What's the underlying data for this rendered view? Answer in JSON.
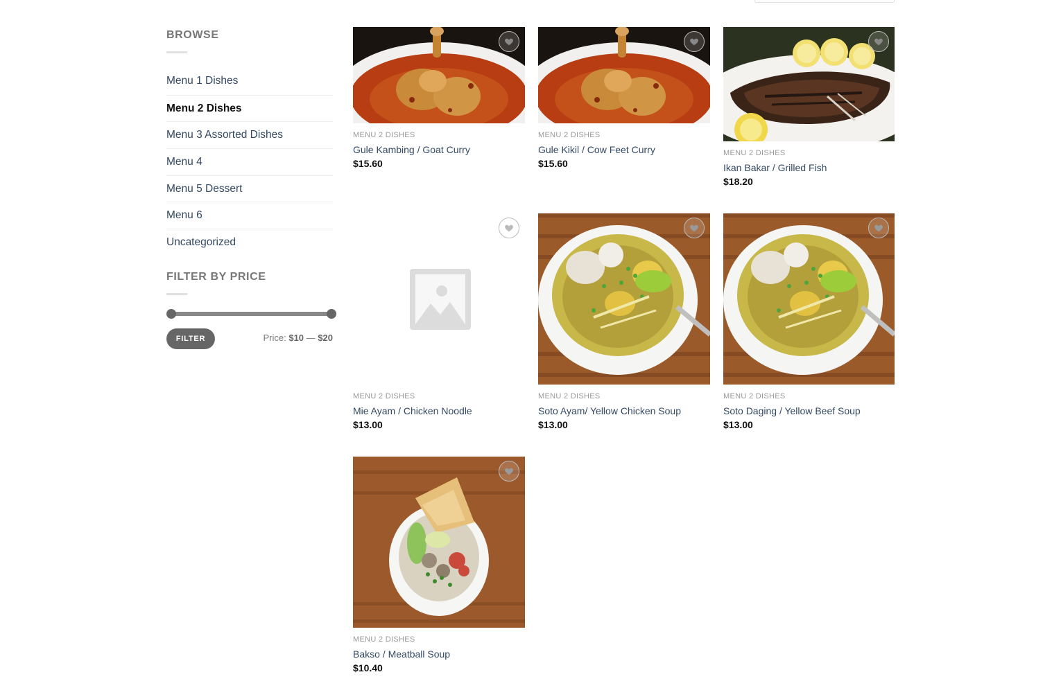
{
  "sidebar": {
    "browse_title": "BROWSE",
    "categories": [
      {
        "label": "Menu 1 Dishes"
      },
      {
        "label": "Menu 2 Dishes"
      },
      {
        "label": "Menu 3 Assorted Dishes"
      },
      {
        "label": "Menu 4"
      },
      {
        "label": "Menu 5 Dessert"
      },
      {
        "label": "Menu 6"
      },
      {
        "label": "Uncategorized"
      }
    ],
    "active_category": "Menu 2 Dishes",
    "price_title": "FILTER BY PRICE",
    "filter_button": "FILTER",
    "price_prefix": "Price:",
    "price_min": "$10",
    "price_separator": "—",
    "price_max": "$20"
  },
  "products": [
    {
      "category": "MENU 2 DISHES",
      "name": "Gule Kambing / Goat Curry",
      "price": "$15.60",
      "image": "curry"
    },
    {
      "category": "MENU 2 DISHES",
      "name": "Gule Kikil / Cow Feet Curry",
      "price": "$15.60",
      "image": "curry"
    },
    {
      "category": "MENU 2 DISHES",
      "name": "Ikan Bakar / Grilled Fish",
      "price": "$18.20",
      "image": "grilled-fish"
    },
    {
      "category": "MENU 2 DISHES",
      "name": "Mie Ayam / Chicken Noodle",
      "price": "$13.00",
      "image": "placeholder"
    },
    {
      "category": "MENU 2 DISHES",
      "name": "Soto Ayam/ Yellow Chicken Soup",
      "price": "$13.00",
      "image": "yellow-soup"
    },
    {
      "category": "MENU 2 DISHES",
      "name": "Soto Daging / Yellow Beef Soup",
      "price": "$13.00",
      "image": "yellow-soup"
    },
    {
      "category": "MENU 2 DISHES",
      "name": "Bakso / Meatball Soup",
      "price": "$10.40",
      "image": "meatball-soup"
    }
  ],
  "colors": {
    "link": "#334862",
    "muted": "#999999",
    "button": "#666666"
  },
  "icons": {
    "wishlist": "heart-icon",
    "placeholder": "image-placeholder-icon"
  }
}
